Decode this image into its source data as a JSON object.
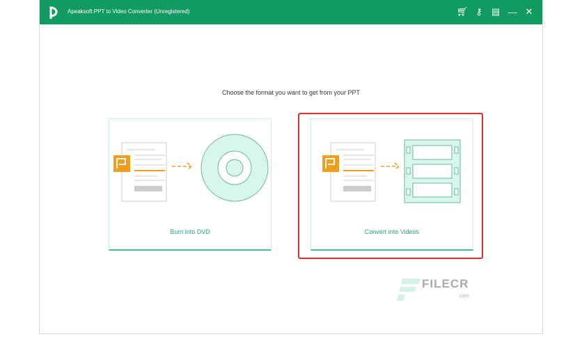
{
  "window": {
    "title": "Apeaksoft PPT to Video Converter (Unregistered)",
    "icons": [
      "cart-icon",
      "key-icon",
      "feedback-icon",
      "minimize-icon",
      "close-icon"
    ]
  },
  "main": {
    "prompt": "Choose the format you want to get from your PPT",
    "options": [
      {
        "label": "Burn into DVD",
        "icon": "dvd-icon"
      },
      {
        "label": "Convert into Videos",
        "icon": "film-icon",
        "selected": true
      }
    ]
  },
  "watermark": {
    "brand": "FILECR",
    "suffix": ".com"
  },
  "colors": {
    "accent": "#129a63",
    "highlight": "#d9302c",
    "orange": "#f29d1c"
  }
}
